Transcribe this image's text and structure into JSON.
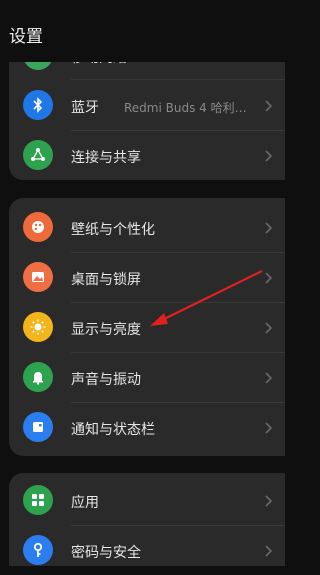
{
  "header": {
    "title": "设置"
  },
  "group1": {
    "items": [
      {
        "label": "移动网络",
        "icon": "mobile-network-icon",
        "color": "#3aa65a"
      },
      {
        "label": "蓝牙",
        "value": "Redmi Buds 4 哈利…",
        "icon": "bluetooth-icon",
        "color": "#1f78e6"
      },
      {
        "label": "连接与共享",
        "icon": "share-icon",
        "color": "#2fa24f"
      }
    ]
  },
  "group2": {
    "items": [
      {
        "label": "壁纸与个性化",
        "icon": "palette-icon",
        "color": "#ee6a3a"
      },
      {
        "label": "桌面与锁屏",
        "icon": "image-icon",
        "color": "#ef6e43"
      },
      {
        "label": "显示与亮度",
        "icon": "sun-icon",
        "color": "#f2b51c"
      },
      {
        "label": "声音与振动",
        "icon": "bell-icon",
        "color": "#2fa24f"
      },
      {
        "label": "通知与状态栏",
        "icon": "notification-icon",
        "color": "#2a7ef0"
      }
    ]
  },
  "group3": {
    "items": [
      {
        "label": "应用",
        "icon": "apps-icon",
        "color": "#2fa24f"
      },
      {
        "label": "密码与安全",
        "icon": "key-icon",
        "color": "#2a7ef0"
      }
    ]
  },
  "annotation": {
    "arrow_color": "#e0221f"
  }
}
